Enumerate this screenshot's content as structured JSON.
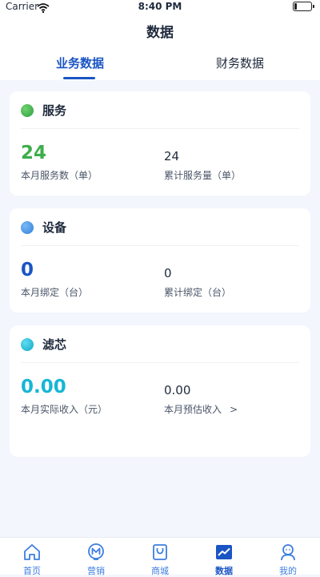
{
  "status_bar": {
    "carrier": "Carrier",
    "time": "8:40 PM"
  },
  "header": {
    "title": "数据",
    "tabs": [
      {
        "label": "业务数据",
        "active": true
      },
      {
        "label": "财务数据",
        "active": false
      }
    ]
  },
  "cards": [
    {
      "title": "服务",
      "dot_color": "#3cae4a",
      "primary": {
        "value": "24",
        "label": "本月服务数（单）",
        "color": "#3cae4a"
      },
      "secondary": {
        "value": "24",
        "label": "累计服务量（单）"
      }
    },
    {
      "title": "设备",
      "dot_color": "#3a8ee6",
      "primary": {
        "value": "0",
        "label": "本月绑定（台）",
        "color": "#1a55c4"
      },
      "secondary": {
        "value": "0",
        "label": "累计绑定（台）"
      }
    },
    {
      "title": "滤芯",
      "dot_color": "#17b6d6",
      "primary": {
        "value": "0.00",
        "label": "本月实际收入（元）",
        "color": "#17b6d6"
      },
      "secondary": {
        "value": "0.00",
        "label": "本月预估收入",
        "chevron": ">"
      }
    }
  ],
  "tab_bar": [
    {
      "label": "首页",
      "icon": "home-icon"
    },
    {
      "label": "营销",
      "icon": "marketing-icon"
    },
    {
      "label": "商城",
      "icon": "shopping-bag-icon"
    },
    {
      "label": "数据",
      "icon": "chart-icon",
      "active": true
    },
    {
      "label": "我的",
      "icon": "user-icon"
    }
  ],
  "colors": {
    "accent": "#1a55c4",
    "tab_icon": "#3d7ee0",
    "background": "#f3f6fc"
  }
}
